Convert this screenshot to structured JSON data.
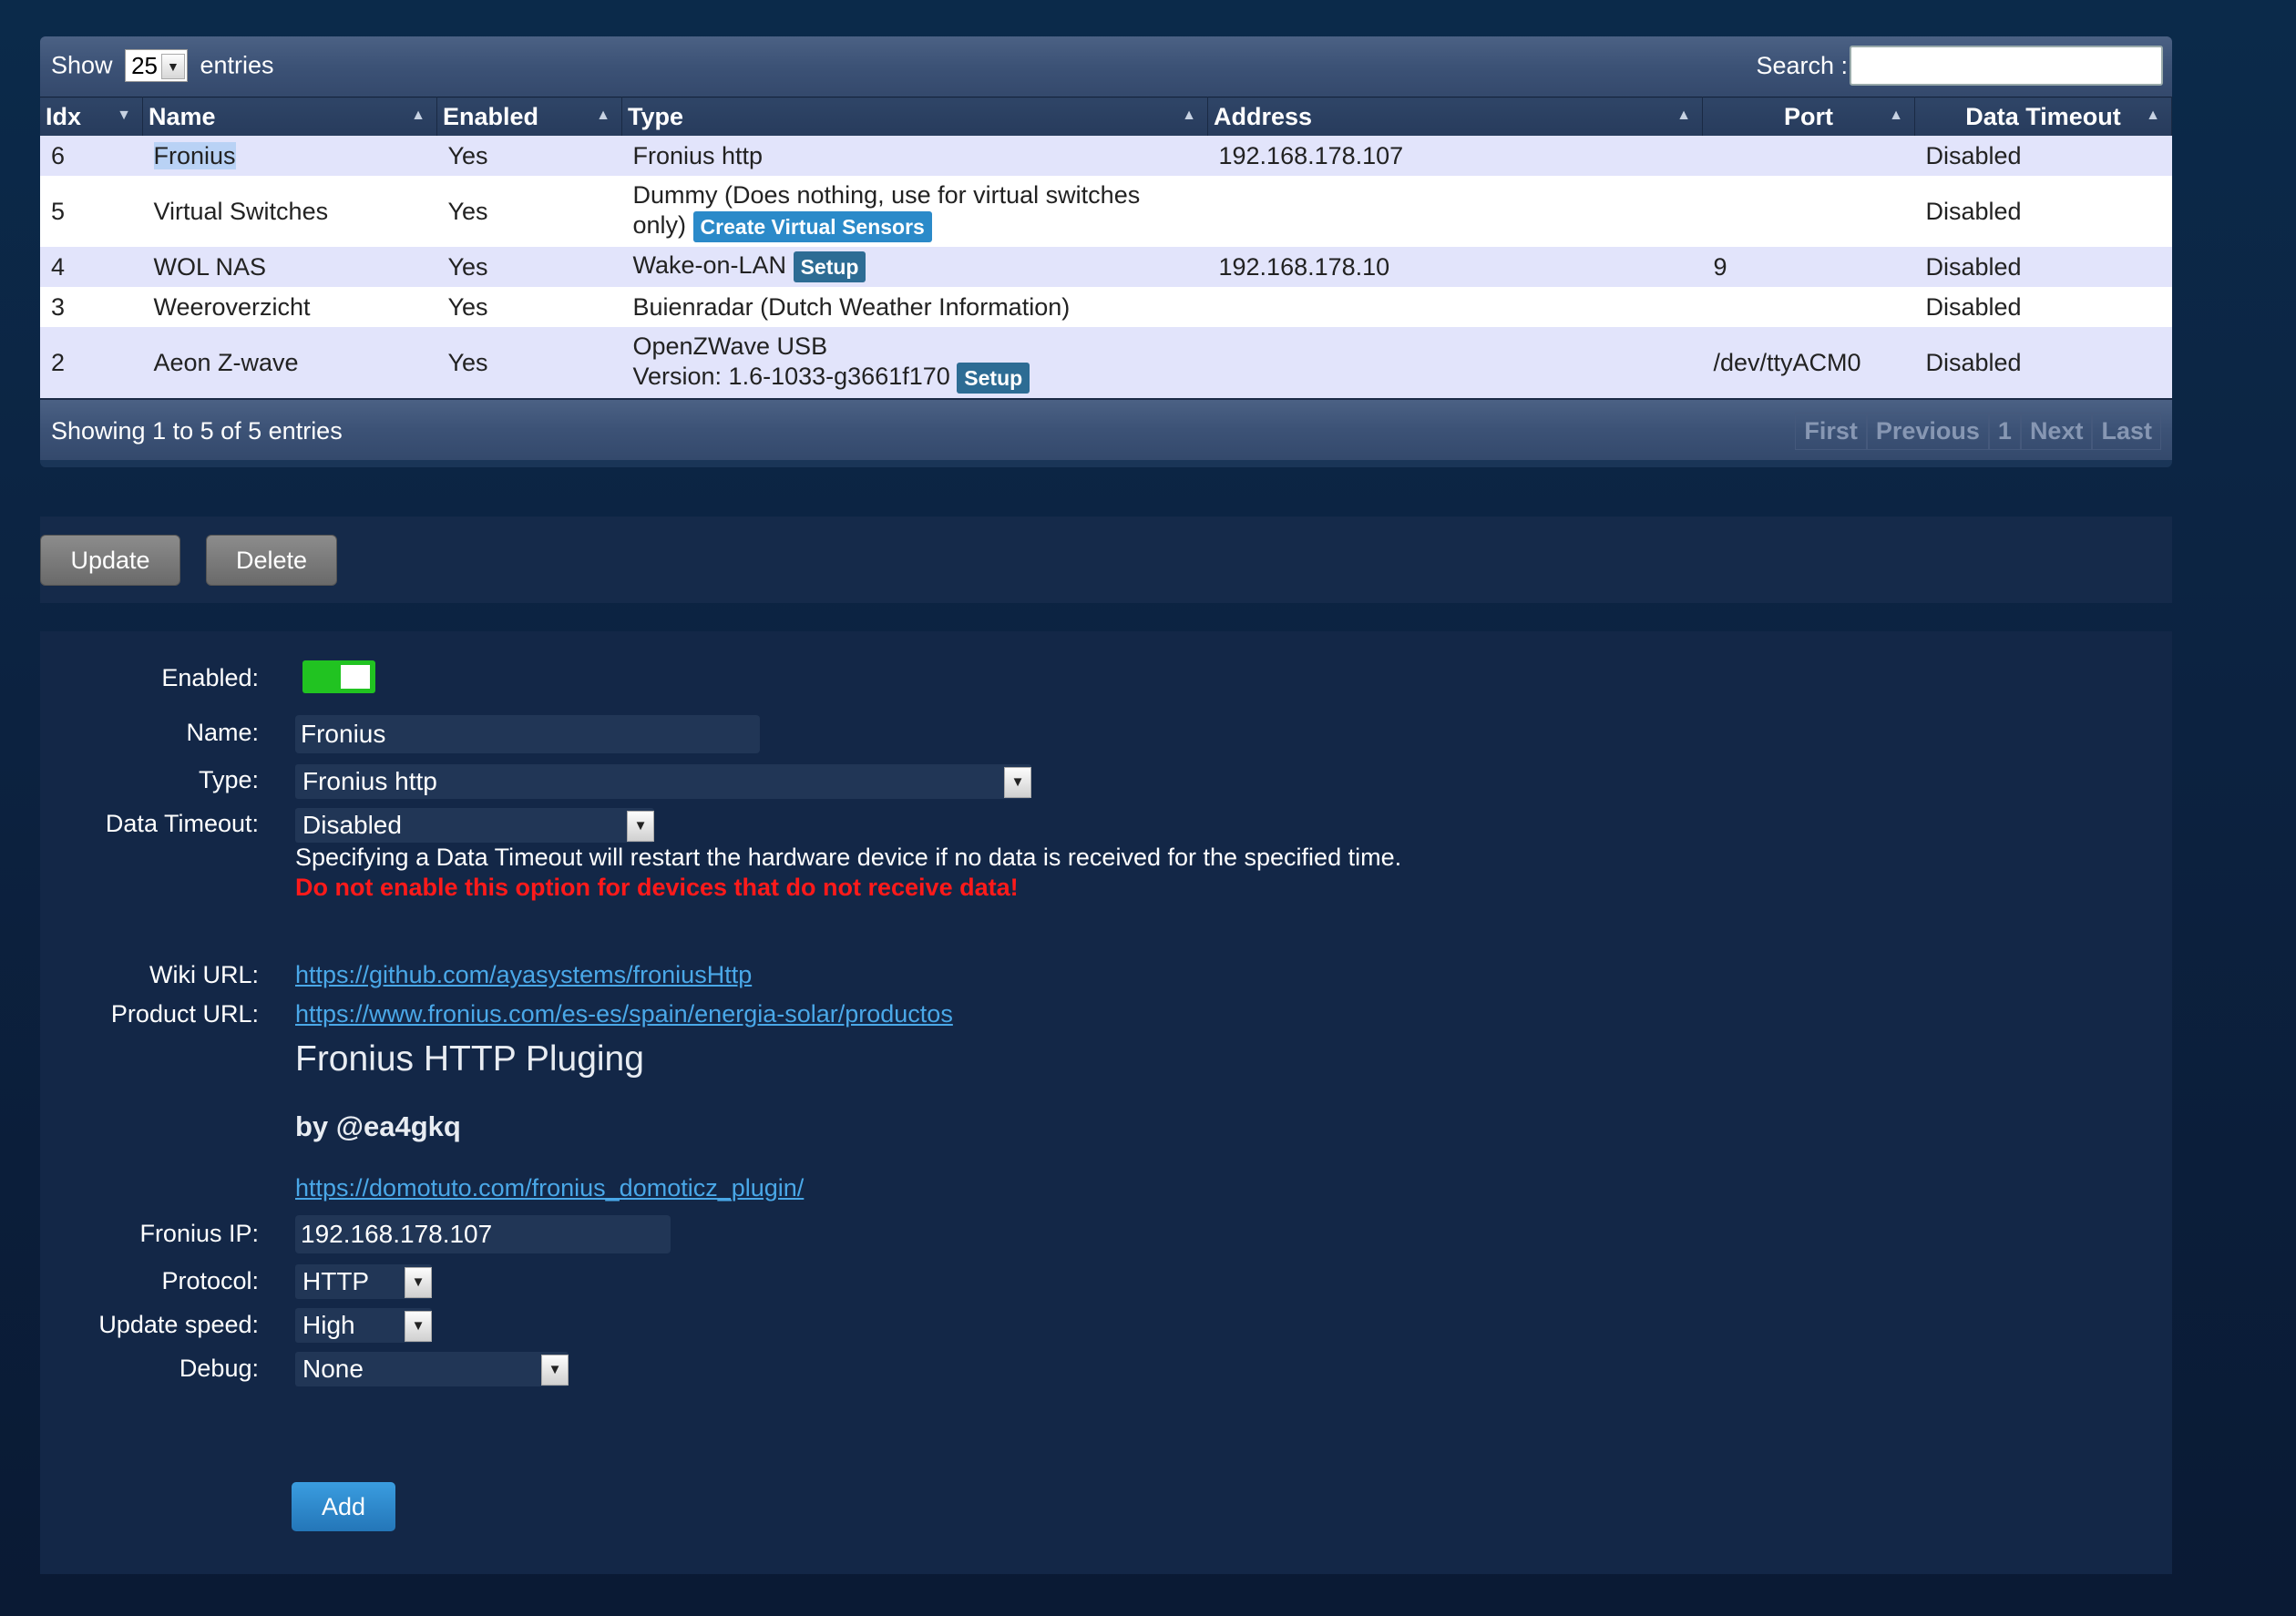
{
  "table_controls": {
    "show_label": "Show",
    "entries_value": "25",
    "entries_label": "entries",
    "search_label": "Search :",
    "search_value": ""
  },
  "columns": [
    "Idx",
    "Name",
    "Enabled",
    "Type",
    "Address",
    "Port",
    "Data Timeout"
  ],
  "rows": [
    {
      "idx": "6",
      "name": "Fronius",
      "enabled": "Yes",
      "type": "Fronius http",
      "type2": "",
      "badge": "",
      "address": "192.168.178.107",
      "port": "",
      "timeout": "Disabled"
    },
    {
      "idx": "5",
      "name": "Virtual Switches",
      "enabled": "Yes",
      "type": "Dummy (Does nothing, use for virtual switches",
      "type2": "only)",
      "badge": "Create Virtual Sensors",
      "address": "",
      "port": "",
      "timeout": "Disabled"
    },
    {
      "idx": "4",
      "name": "WOL NAS",
      "enabled": "Yes",
      "type": "Wake-on-LAN",
      "type2": "",
      "badge": "Setup",
      "address": "192.168.178.10",
      "port": "9",
      "timeout": "Disabled"
    },
    {
      "idx": "3",
      "name": "Weeroverzicht",
      "enabled": "Yes",
      "type": "Buienradar (Dutch Weather Information)",
      "type2": "",
      "badge": "",
      "address": "",
      "port": "",
      "timeout": "Disabled"
    },
    {
      "idx": "2",
      "name": "Aeon Z-wave",
      "enabled": "Yes",
      "type": "OpenZWave USB",
      "type2": "Version: 1.6-1033-g3661f170",
      "badge": "Setup",
      "address": "",
      "port": "/dev/ttyACM0",
      "timeout": "Disabled"
    }
  ],
  "footer": {
    "showing": "Showing 1 to 5 of 5 entries",
    "pager": [
      "First",
      "Previous",
      "1",
      "Next",
      "Last"
    ]
  },
  "actions": {
    "update": "Update",
    "delete": "Delete"
  },
  "form": {
    "enabled_label": "Enabled:",
    "enabled": true,
    "name_label": "Name:",
    "name_value": "Fronius",
    "type_label": "Type:",
    "type_value": "Fronius http",
    "timeout_label": "Data Timeout:",
    "timeout_value": "Disabled",
    "timeout_help": "Specifying a Data Timeout will restart the hardware device if no data is received for the specified time.",
    "timeout_warning": "Do not enable this option for devices that do not receive data!",
    "wiki_label": "Wiki URL:",
    "wiki_url": "https://github.com/ayasystems/froniusHttp",
    "product_label": "Product URL:",
    "product_url": "https://www.fronius.com/es-es/spain/energia-solar/productos",
    "plugin_title": "Fronius HTTP Pluging",
    "plugin_author": "by @ea4gkq",
    "plugin_link": "https://domotuto.com/fronius_domoticz_plugin/",
    "ip_label": "Fronius IP:",
    "ip_value": "192.168.178.107",
    "protocol_label": "Protocol:",
    "protocol_value": "HTTP",
    "speed_label": "Update speed:",
    "speed_value": "High",
    "debug_label": "Debug:",
    "debug_value": "None",
    "add_label": "Add"
  },
  "colors": {
    "background": "#0c2240",
    "toggle_on": "#21c321",
    "link": "#4aa8e8",
    "warning": "#ff1a1a",
    "badge_create": "#2b8ac9",
    "badge_setup": "#2d6c94"
  }
}
